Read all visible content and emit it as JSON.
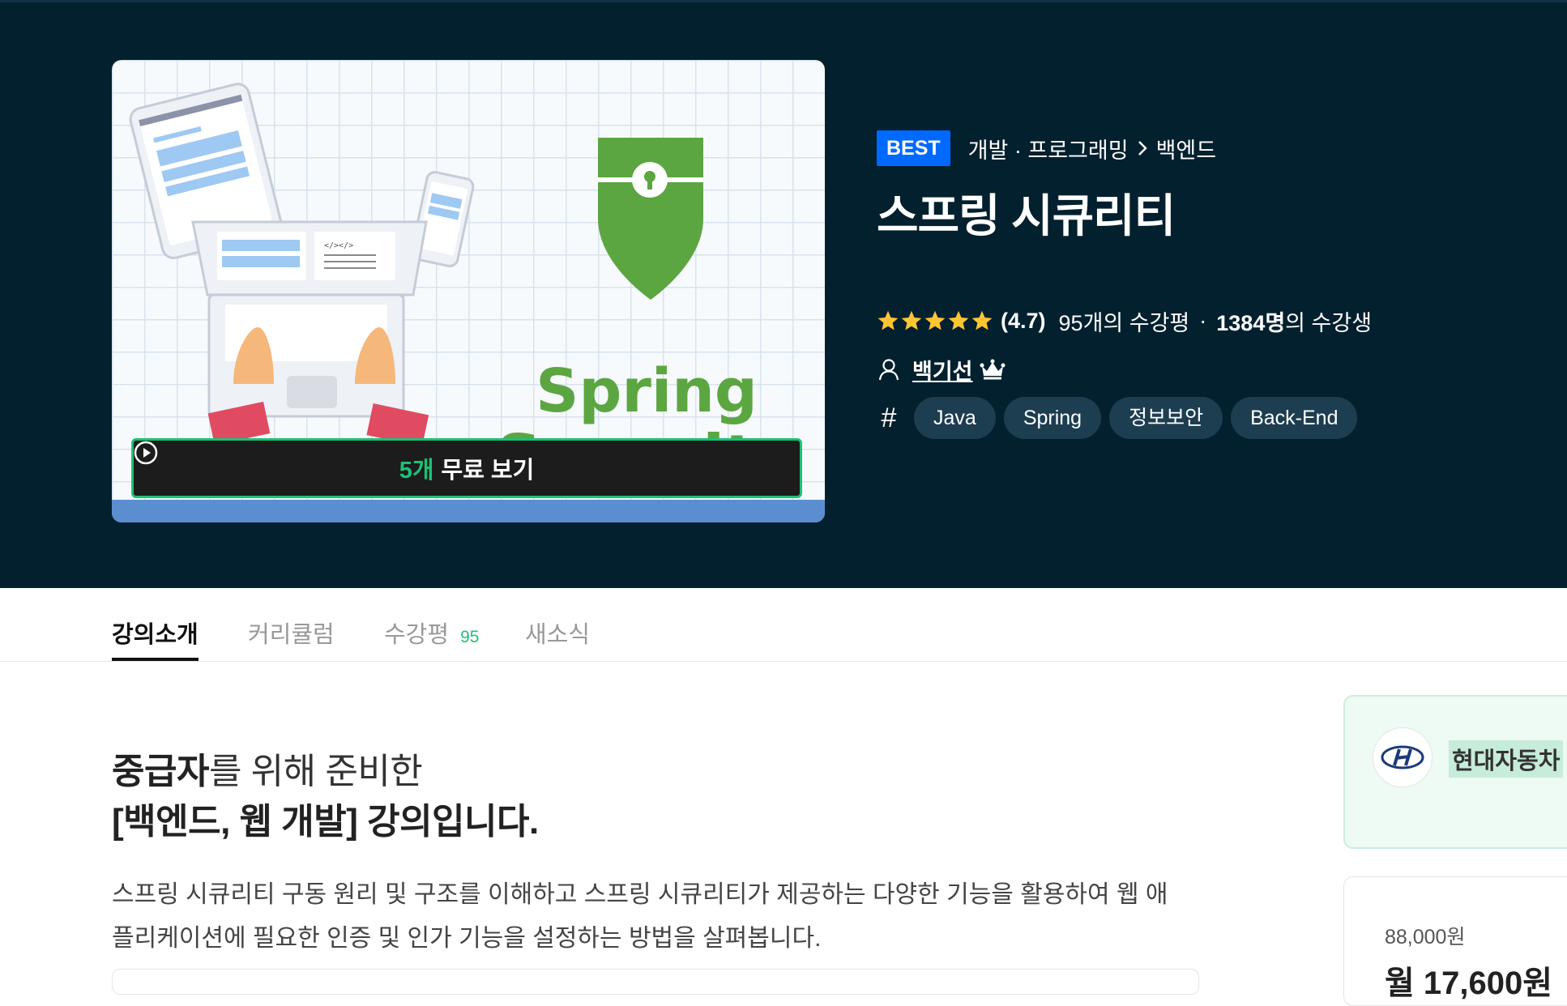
{
  "hero": {
    "thumbnail": {
      "line1": "Spring",
      "line2": "Security",
      "code_text": "</></>"
    },
    "preview_button": {
      "count": "5개",
      "label": "무료 보기"
    },
    "badge": "BEST",
    "breadcrumb": {
      "category": "개발 · 프로그래밍",
      "subcategory": "백엔드"
    },
    "title": "스프링 시큐리티",
    "rating": {
      "stars": 5,
      "score": "(4.7)",
      "reviews": "95개의 수강평",
      "students_count": "1384명",
      "students_suffix": "의 수강생"
    },
    "instructor": "백기선",
    "tags": [
      "Java",
      "Spring",
      "정보보안",
      "Back-End"
    ]
  },
  "tabs": [
    {
      "label": "강의소개"
    },
    {
      "label": "커리큘럼"
    },
    {
      "label": "수강평",
      "count": "95"
    },
    {
      "label": "새소식"
    }
  ],
  "intro": {
    "level": "중급자",
    "line1_rest": "를 위해 준비한",
    "line2": "[백엔드, 웹 개발] 강의입니다.",
    "description": "스프링 시큐리티 구동 원리 및 구조를 이해하고 스프링 시큐리티가 제공하는 다양한 기능을 활용하여 웹 애플리케이션에 필요한 인증 및 인가 기능을 설정하는 방법을 살펴봅니다."
  },
  "sidebar": {
    "promo_text": "현대자동차 ",
    "original_price": "88,000원",
    "sale_price": "월 17,600원"
  },
  "colors": {
    "hero_bg": "#03202f",
    "accent_green": "#1ec076",
    "best_blue": "#0069ff",
    "star": "#fdc532",
    "shield": "#5ca641"
  }
}
